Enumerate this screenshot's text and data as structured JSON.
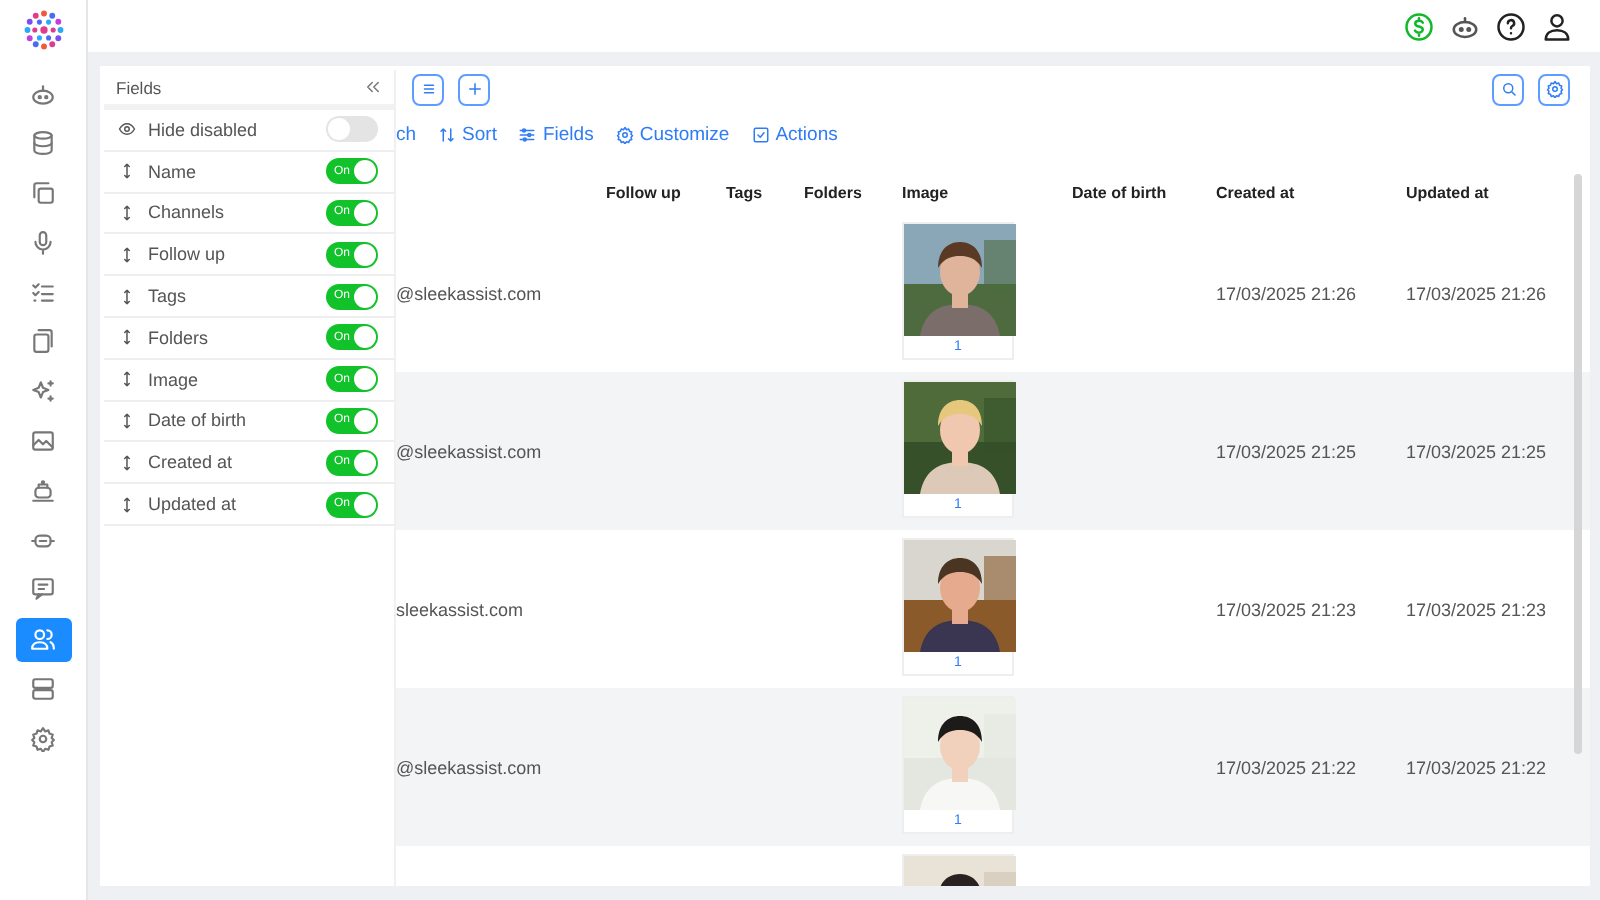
{
  "sidebar": {
    "items": [
      {
        "selected": false
      },
      {
        "selected": false
      },
      {
        "selected": false
      },
      {
        "selected": false
      },
      {
        "selected": false
      },
      {
        "selected": false
      },
      {
        "selected": false
      },
      {
        "selected": false
      },
      {
        "selected": false
      },
      {
        "selected": false
      },
      {
        "selected": false
      },
      {
        "selected": true
      },
      {
        "selected": false
      },
      {
        "selected": false
      }
    ]
  },
  "fields_panel": {
    "title": "Fields",
    "hide_disabled": {
      "label": "Hide disabled",
      "on": false
    },
    "fields": [
      {
        "label": "Name",
        "on": true,
        "toggle_text": "On"
      },
      {
        "label": "Channels",
        "on": true,
        "toggle_text": "On"
      },
      {
        "label": "Follow up",
        "on": true,
        "toggle_text": "On"
      },
      {
        "label": "Tags",
        "on": true,
        "toggle_text": "On"
      },
      {
        "label": "Folders",
        "on": true,
        "toggle_text": "On"
      },
      {
        "label": "Image",
        "on": true,
        "toggle_text": "On"
      },
      {
        "label": "Date of birth",
        "on": true,
        "toggle_text": "On"
      },
      {
        "label": "Created at",
        "on": true,
        "toggle_text": "On"
      },
      {
        "label": "Updated at",
        "on": true,
        "toggle_text": "On"
      }
    ]
  },
  "toolbar": {
    "actions": [
      {
        "kind": "plain",
        "label": "ch"
      },
      {
        "kind": "sort",
        "label": "Sort"
      },
      {
        "kind": "fields",
        "label": "Fields"
      },
      {
        "kind": "customize",
        "label": "Customize"
      },
      {
        "kind": "actions",
        "label": "Actions"
      }
    ]
  },
  "table": {
    "columns": [
      "Follow up",
      "Tags",
      "Folders",
      "Image",
      "Date of birth",
      "Created at",
      "Updated at"
    ],
    "rows": [
      {
        "email": "@sleekassist.com",
        "image": {
          "kind": "picture",
          "count": "1"
        },
        "created_at": "17/03/2025 21:26",
        "updated_at": "17/03/2025 21:26"
      },
      {
        "email": "@sleekassist.com",
        "image": {
          "kind": "picture",
          "count": "1"
        },
        "created_at": "17/03/2025 21:25",
        "updated_at": "17/03/2025 21:25"
      },
      {
        "email": "sleekassist.com",
        "image": {
          "kind": "picture",
          "count": "1"
        },
        "created_at": "17/03/2025 21:23",
        "updated_at": "17/03/2025 21:23"
      },
      {
        "email": "@sleekassist.com",
        "image": {
          "kind": "picture",
          "count": "1"
        },
        "created_at": "17/03/2025 21:22",
        "updated_at": "17/03/2025 21:22"
      },
      {
        "image": {
          "kind": "picture"
        }
      }
    ]
  }
}
